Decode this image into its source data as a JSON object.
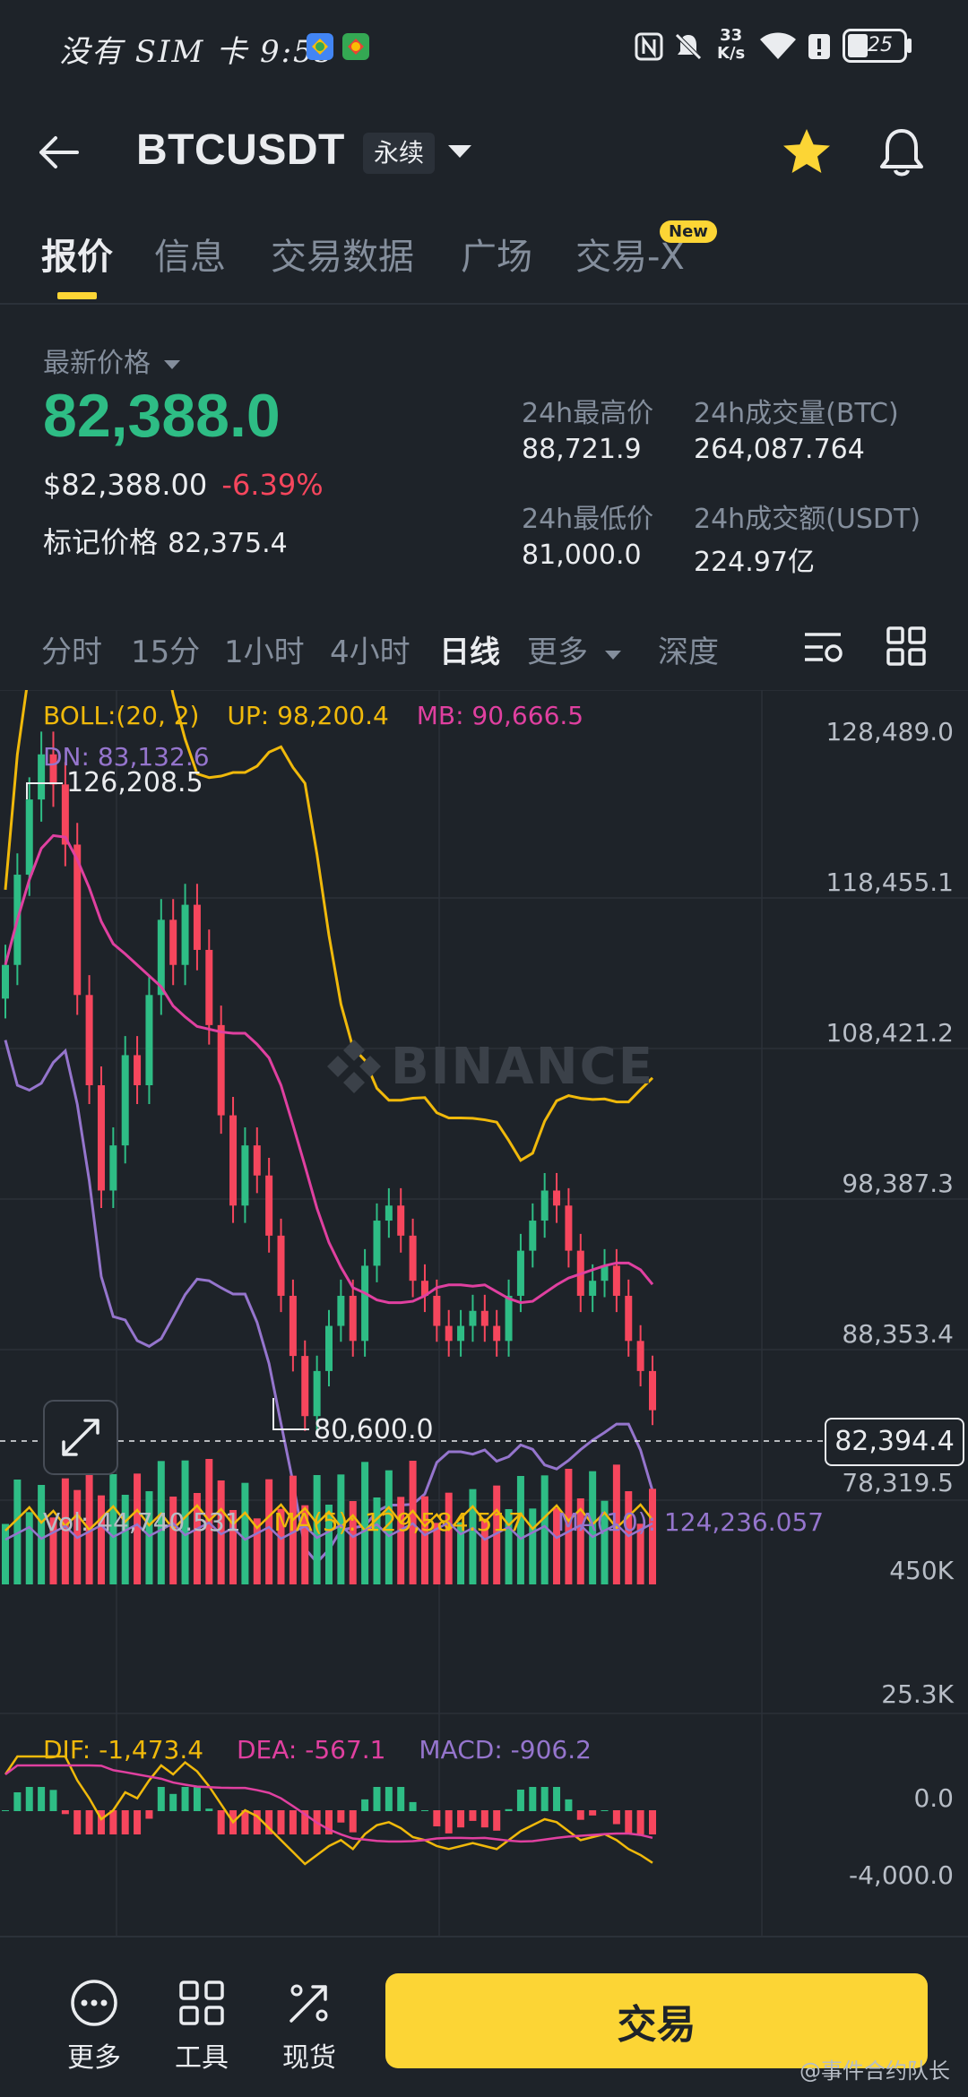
{
  "status_bar": {
    "carrier_time": "没有 SIM 卡 9:55",
    "net_speed": "33\nK/s",
    "battery": "25"
  },
  "header": {
    "symbol": "BTCUSDT",
    "contract_type": "永续"
  },
  "tabs": [
    {
      "label": "报价",
      "active": true
    },
    {
      "label": "信息",
      "active": false
    },
    {
      "label": "交易数据",
      "active": false
    },
    {
      "label": "广场",
      "active": false
    },
    {
      "label": "交易-X",
      "active": false,
      "badge": "New"
    }
  ],
  "ticker": {
    "latest_price_label": "最新价格",
    "latest_price": "82,388.0",
    "usd_value": "$82,388.00",
    "change_pct": "-6.39%",
    "mark_price_label": "标记价格",
    "mark_price": "82,375.4",
    "high_label": "24h最高价",
    "high": "88,721.9",
    "low_label": "24h最低价",
    "low": "81,000.0",
    "vol_btc_label": "24h成交量(BTC)",
    "vol_btc": "264,087.764",
    "vol_usdt_label": "24h成交额(USDT)",
    "vol_usdt": "224.97亿"
  },
  "intervals": [
    {
      "label": "分时",
      "active": false
    },
    {
      "label": "15分",
      "active": false
    },
    {
      "label": "1小时",
      "active": false
    },
    {
      "label": "4小时",
      "active": false
    },
    {
      "label": "日线",
      "active": true
    },
    {
      "label": "更多",
      "active": false
    },
    {
      "label": "深度",
      "active": false
    }
  ],
  "indicators": {
    "boll": "BOLL:(20, 2)",
    "up": "UP: 98,200.4",
    "mb": "MB: 90,666.5",
    "dn": "DN: 83,132.6",
    "vol": "Vol: 44,740.531",
    "ma5": "MA(5): 129,584.517",
    "ma10": "MA(10): 124,236.057",
    "dif": "DIF: -1,473.4",
    "dea": "DEA: -567.1",
    "macd": "MACD: -906.2"
  },
  "price_axis": [
    "128,489.0",
    "118,455.1",
    "108,421.2",
    "98,387.3",
    "88,353.4",
    "78,319.5"
  ],
  "current_price_tag": "82,394.4",
  "high_marker": "126,208.5",
  "low_marker": "80,600.0",
  "vol_axis": [
    "450K",
    "25.3K"
  ],
  "macd_axis": [
    "0.0",
    "-4,000.0"
  ],
  "watermark": "BINANCE",
  "bottom_nav": [
    {
      "label": "更多"
    },
    {
      "label": "工具"
    },
    {
      "label": "现货"
    }
  ],
  "trade_button": "交易",
  "credit": "@事件合约队长",
  "colors": {
    "up": "#2ebd85",
    "down": "#f6465d",
    "yellow": "#fcd535",
    "boll_up": "#f0b90b",
    "boll_mb": "#e040a0",
    "boll_dn": "#9575cd"
  },
  "chart_data": {
    "type": "candlestick",
    "price_ylim": [
      78319.5,
      128489.0
    ],
    "close_approx": [
      112000,
      118000,
      123000,
      126000,
      124000,
      120000,
      110000,
      104000,
      97000,
      100000,
      106000,
      104000,
      110000,
      115000,
      112000,
      116000,
      113000,
      108000,
      102000,
      96000,
      100000,
      98000,
      94000,
      90000,
      86000,
      82000,
      85000,
      88000,
      90000,
      87000,
      92000,
      95000,
      96000,
      94000,
      91000,
      90000,
      88000,
      87000,
      88000,
      89000,
      88000,
      87000,
      90000,
      93000,
      95000,
      97000,
      96000,
      93000,
      90000,
      91000,
      92000,
      90000,
      87000,
      85000,
      82394
    ]
  }
}
